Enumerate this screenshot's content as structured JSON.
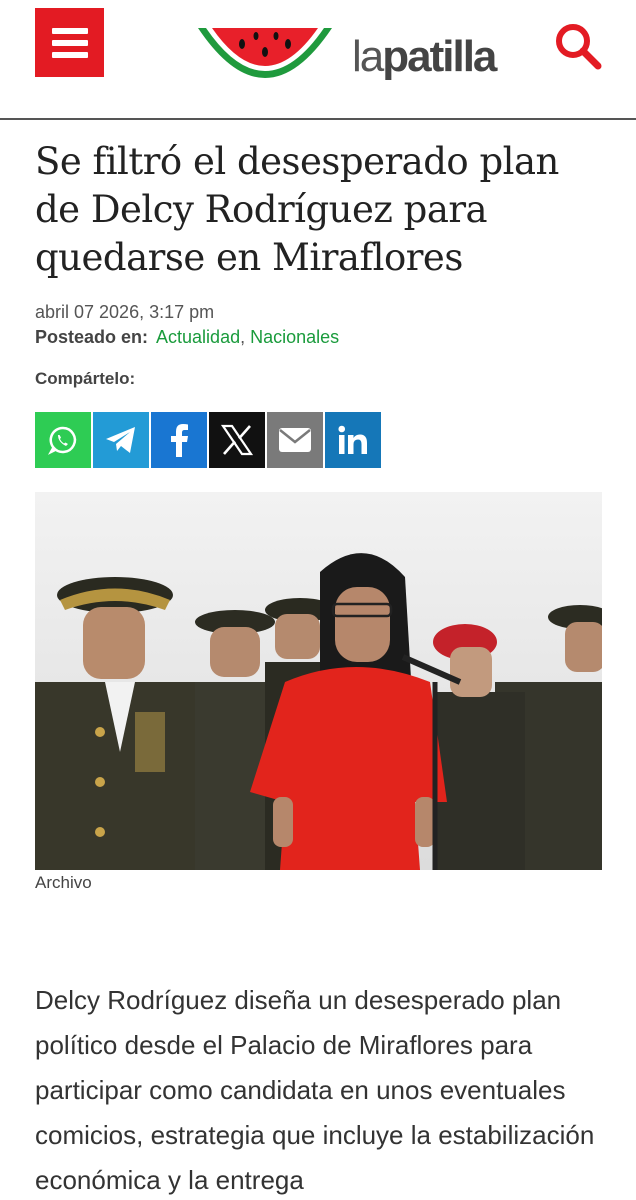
{
  "header": {
    "menu_icon": "hamburger-icon",
    "logo_light": "la",
    "logo_bold": "patilla",
    "logo_icon": "watermelon-logo",
    "search_icon": "search-icon",
    "brand_color": "#e31b23"
  },
  "article": {
    "title": "Se filtró el desesperado plan de Delcy Rodríguez para quedarse en Miraflores",
    "date": "abril 07 2026, 3:17 pm",
    "posted_label": "Posteado en:",
    "categories": [
      "Actualidad",
      "Nacionales"
    ],
    "category_sep": ", ",
    "share_label": "Compártelo:",
    "share_buttons": [
      {
        "name": "whatsapp",
        "icon": "whatsapp-icon",
        "color": "#2ecc54"
      },
      {
        "name": "telegram",
        "icon": "telegram-icon",
        "color": "#239bd6"
      },
      {
        "name": "facebook",
        "icon": "facebook-icon",
        "color": "#1976d2"
      },
      {
        "name": "x",
        "icon": "x-icon",
        "color": "#111111"
      },
      {
        "name": "email",
        "icon": "mail-icon",
        "color": "#7a7a7a"
      },
      {
        "name": "linkedin",
        "icon": "linkedin-icon",
        "color": "#1577b8"
      }
    ],
    "photo_caption": "Archivo",
    "body_text": "Delcy Rodríguez diseña un desesperado plan político desde el Palacio de Miraflores para participar como candidata en unos eventuales comicios, estrategia que incluye la estabilización económica y la entrega"
  }
}
